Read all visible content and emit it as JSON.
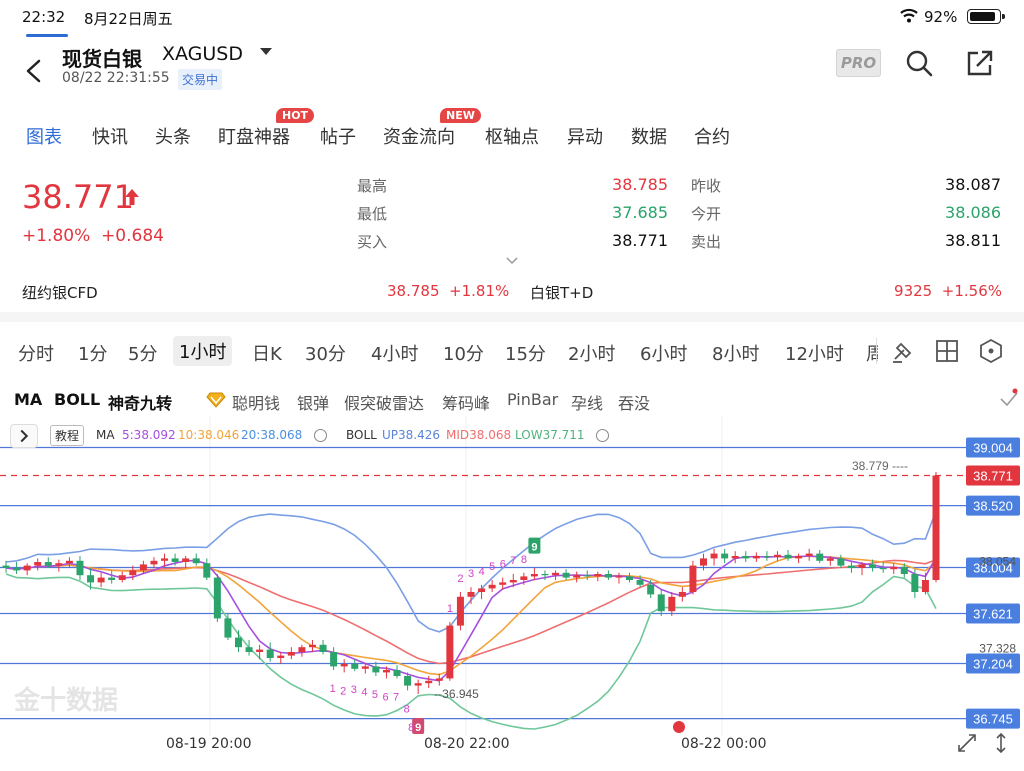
{
  "status": {
    "time": "22:32",
    "date": "8月22日周五",
    "battery": "92%",
    "battery_level": 0.92
  },
  "header": {
    "title": "现货白银",
    "symbol": "XAGUSD",
    "timestamp": "08/22 22:31:55",
    "trade_status": "交易中",
    "pro_label": "PRO"
  },
  "tabs": [
    {
      "label": "图表",
      "active": true
    },
    {
      "label": "快讯"
    },
    {
      "label": "头条"
    },
    {
      "label": "盯盘神器",
      "badge": "HOT"
    },
    {
      "label": "帖子"
    },
    {
      "label": "资金流向",
      "badge": "NEW"
    },
    {
      "label": "枢轴点"
    },
    {
      "label": "异动"
    },
    {
      "label": "数据"
    },
    {
      "label": "合约"
    }
  ],
  "quote": {
    "price": "38.771",
    "change_pct": "+1.80%",
    "change": "+0.684",
    "high_label": "最高",
    "high": "38.785",
    "low_label": "最低",
    "low": "37.685",
    "bid_label": "买入",
    "bid": "38.771",
    "prev_close_label": "昨收",
    "prev_close": "38.087",
    "open_label": "今开",
    "open": "38.086",
    "ask_label": "卖出",
    "ask": "38.811"
  },
  "related": [
    {
      "name": "纽约银CFD",
      "price": "38.785",
      "chg": "+1.81%"
    },
    {
      "name": "白银T+D",
      "price": "9325",
      "chg": "+1.56%"
    }
  ],
  "periods": [
    "分时",
    "1分",
    "5分",
    "1小时",
    "日K",
    "30分",
    "4小时",
    "10分",
    "15分",
    "2小时",
    "6小时",
    "8小时",
    "12小时",
    "周"
  ],
  "active_period": "1小时",
  "indicators": [
    "MA",
    "BOLL",
    "神奇九转",
    "聪明钱",
    "银弹",
    "假突破雷达",
    "筹码峰",
    "PinBar",
    "孕线",
    "吞没"
  ],
  "legend": {
    "tutorial": "教程",
    "ma_label": "MA",
    "ma5": "5:38.092",
    "ma10": "10:38.046",
    "ma20": "20:38.068",
    "boll_label": "BOLL",
    "up": "UP38.426",
    "mid": "MID38.068",
    "low": "LOW37.711"
  },
  "colors": {
    "up": "#e2363f",
    "down": "#2ba36a",
    "accent": "#2d6bd6",
    "ma5": "#a64fe0",
    "ma10": "#f2a33a",
    "ma20": "#ef6f6f",
    "boll_up": "#7b9fe6",
    "boll_low": "#6fc79a"
  },
  "watermark": "金十数据",
  "chart_data": {
    "type": "candlestick",
    "ylim": [
      36.6,
      39.1
    ],
    "price_levels": [
      "39.004",
      "38.520",
      "38.004",
      "37.621",
      "37.204",
      "36.745"
    ],
    "current_price": "38.771",
    "max_label": "38.779",
    "min_label": "36.945",
    "axis_ticks": [
      "38.054",
      "37.328"
    ],
    "x_labels": [
      "08-19 20:00",
      "08-20 22:00",
      "08-22 00:00"
    ],
    "td_up_counts": [
      "1",
      "2",
      "3",
      "4",
      "5",
      "6",
      "7",
      "8",
      "9"
    ],
    "td_down_counts": [
      "1",
      "2",
      "3",
      "4",
      "5",
      "6",
      "7",
      "8",
      "9"
    ],
    "candles": [
      [
        38.02,
        38.06,
        37.96,
        38.0
      ],
      [
        38.0,
        38.05,
        37.95,
        37.98
      ],
      [
        37.98,
        38.04,
        37.94,
        38.02
      ],
      [
        38.02,
        38.08,
        37.98,
        38.05
      ],
      [
        38.05,
        38.09,
        38.0,
        38.02
      ],
      [
        38.02,
        38.07,
        37.97,
        38.04
      ],
      [
        38.04,
        38.09,
        38.0,
        38.06
      ],
      [
        38.06,
        38.1,
        37.9,
        37.94
      ],
      [
        37.94,
        38.0,
        37.82,
        37.88
      ],
      [
        37.88,
        37.96,
        37.84,
        37.92
      ],
      [
        37.92,
        37.98,
        37.87,
        37.9
      ],
      [
        37.9,
        37.97,
        37.88,
        37.94
      ],
      [
        37.94,
        38.02,
        37.9,
        37.98
      ],
      [
        37.98,
        38.06,
        37.95,
        38.03
      ],
      [
        38.03,
        38.09,
        38.0,
        38.06
      ],
      [
        38.06,
        38.12,
        38.01,
        38.08
      ],
      [
        38.08,
        38.12,
        38.02,
        38.05
      ],
      [
        38.05,
        38.1,
        38.0,
        38.08
      ],
      [
        38.08,
        38.12,
        38.02,
        38.04
      ],
      [
        38.04,
        38.08,
        37.9,
        37.92
      ],
      [
        37.92,
        37.95,
        37.55,
        37.58
      ],
      [
        37.58,
        37.62,
        37.4,
        37.42
      ],
      [
        37.42,
        37.48,
        37.3,
        37.34
      ],
      [
        37.34,
        37.4,
        37.27,
        37.3
      ],
      [
        37.3,
        37.36,
        37.24,
        37.32
      ],
      [
        37.32,
        37.38,
        37.22,
        37.25
      ],
      [
        37.25,
        37.3,
        37.2,
        37.27
      ],
      [
        37.27,
        37.34,
        37.24,
        37.3
      ],
      [
        37.3,
        37.36,
        37.26,
        37.34
      ],
      [
        37.34,
        37.4,
        37.3,
        37.36
      ],
      [
        37.36,
        37.4,
        37.28,
        37.3
      ],
      [
        37.3,
        37.34,
        37.15,
        37.18
      ],
      [
        37.18,
        37.24,
        37.13,
        37.2
      ],
      [
        37.2,
        37.24,
        37.14,
        37.16
      ],
      [
        37.16,
        37.21,
        37.12,
        37.18
      ],
      [
        37.18,
        37.22,
        37.1,
        37.13
      ],
      [
        37.13,
        37.18,
        37.08,
        37.15
      ],
      [
        37.15,
        37.19,
        37.08,
        37.1
      ],
      [
        37.1,
        37.13,
        36.98,
        37.02
      ],
      [
        37.02,
        37.07,
        36.95,
        37.04
      ],
      [
        37.04,
        37.1,
        37.0,
        37.06
      ],
      [
        37.06,
        37.12,
        37.02,
        37.08
      ],
      [
        37.08,
        37.55,
        37.06,
        37.52
      ],
      [
        37.52,
        37.8,
        37.48,
        37.76
      ],
      [
        37.76,
        37.84,
        37.7,
        37.8
      ],
      [
        37.8,
        37.86,
        37.74,
        37.83
      ],
      [
        37.83,
        37.9,
        37.8,
        37.86
      ],
      [
        37.86,
        37.92,
        37.82,
        37.88
      ],
      [
        37.88,
        37.95,
        37.84,
        37.9
      ],
      [
        37.9,
        37.96,
        37.86,
        37.93
      ],
      [
        37.93,
        38.0,
        37.9,
        37.95
      ],
      [
        37.95,
        37.98,
        37.9,
        37.94
      ],
      [
        37.94,
        37.98,
        37.9,
        37.96
      ],
      [
        37.96,
        37.99,
        37.9,
        37.92
      ],
      [
        37.92,
        37.97,
        37.88,
        37.94
      ],
      [
        37.94,
        37.98,
        37.9,
        37.93
      ],
      [
        37.93,
        37.97,
        37.89,
        37.95
      ],
      [
        37.95,
        37.98,
        37.9,
        37.92
      ],
      [
        37.92,
        37.96,
        37.87,
        37.93
      ],
      [
        37.93,
        37.96,
        37.88,
        37.9
      ],
      [
        37.9,
        37.94,
        37.84,
        37.86
      ],
      [
        37.86,
        37.9,
        37.75,
        37.78
      ],
      [
        37.78,
        37.82,
        37.6,
        37.64
      ],
      [
        37.64,
        37.8,
        37.6,
        37.76
      ],
      [
        37.76,
        37.84,
        37.72,
        37.8
      ],
      [
        37.8,
        38.06,
        37.78,
        38.02
      ],
      [
        38.02,
        38.12,
        37.98,
        38.08
      ],
      [
        38.08,
        38.16,
        38.02,
        38.12
      ],
      [
        38.12,
        38.16,
        38.04,
        38.08
      ],
      [
        38.08,
        38.14,
        38.04,
        38.1
      ],
      [
        38.1,
        38.14,
        38.05,
        38.08
      ],
      [
        38.08,
        38.13,
        38.05,
        38.1
      ],
      [
        38.1,
        38.14,
        38.06,
        38.09
      ],
      [
        38.09,
        38.14,
        38.06,
        38.11
      ],
      [
        38.11,
        38.15,
        38.06,
        38.08
      ],
      [
        38.08,
        38.12,
        38.04,
        38.1
      ],
      [
        38.1,
        38.16,
        38.06,
        38.12
      ],
      [
        38.12,
        38.15,
        38.04,
        38.06
      ],
      [
        38.06,
        38.1,
        38.02,
        38.08
      ],
      [
        38.08,
        38.11,
        38.0,
        38.02
      ],
      [
        38.02,
        38.06,
        37.96,
        38.0
      ],
      [
        38.0,
        38.05,
        37.94,
        38.03
      ],
      [
        38.03,
        38.07,
        37.97,
        38.0
      ],
      [
        38.0,
        38.05,
        37.96,
        37.99
      ],
      [
        37.99,
        38.04,
        37.95,
        38.01
      ],
      [
        38.01,
        38.04,
        37.92,
        37.95
      ],
      [
        37.95,
        37.99,
        37.75,
        37.8
      ],
      [
        37.8,
        37.96,
        37.78,
        37.9
      ],
      [
        37.9,
        38.8,
        37.88,
        38.771
      ]
    ]
  }
}
